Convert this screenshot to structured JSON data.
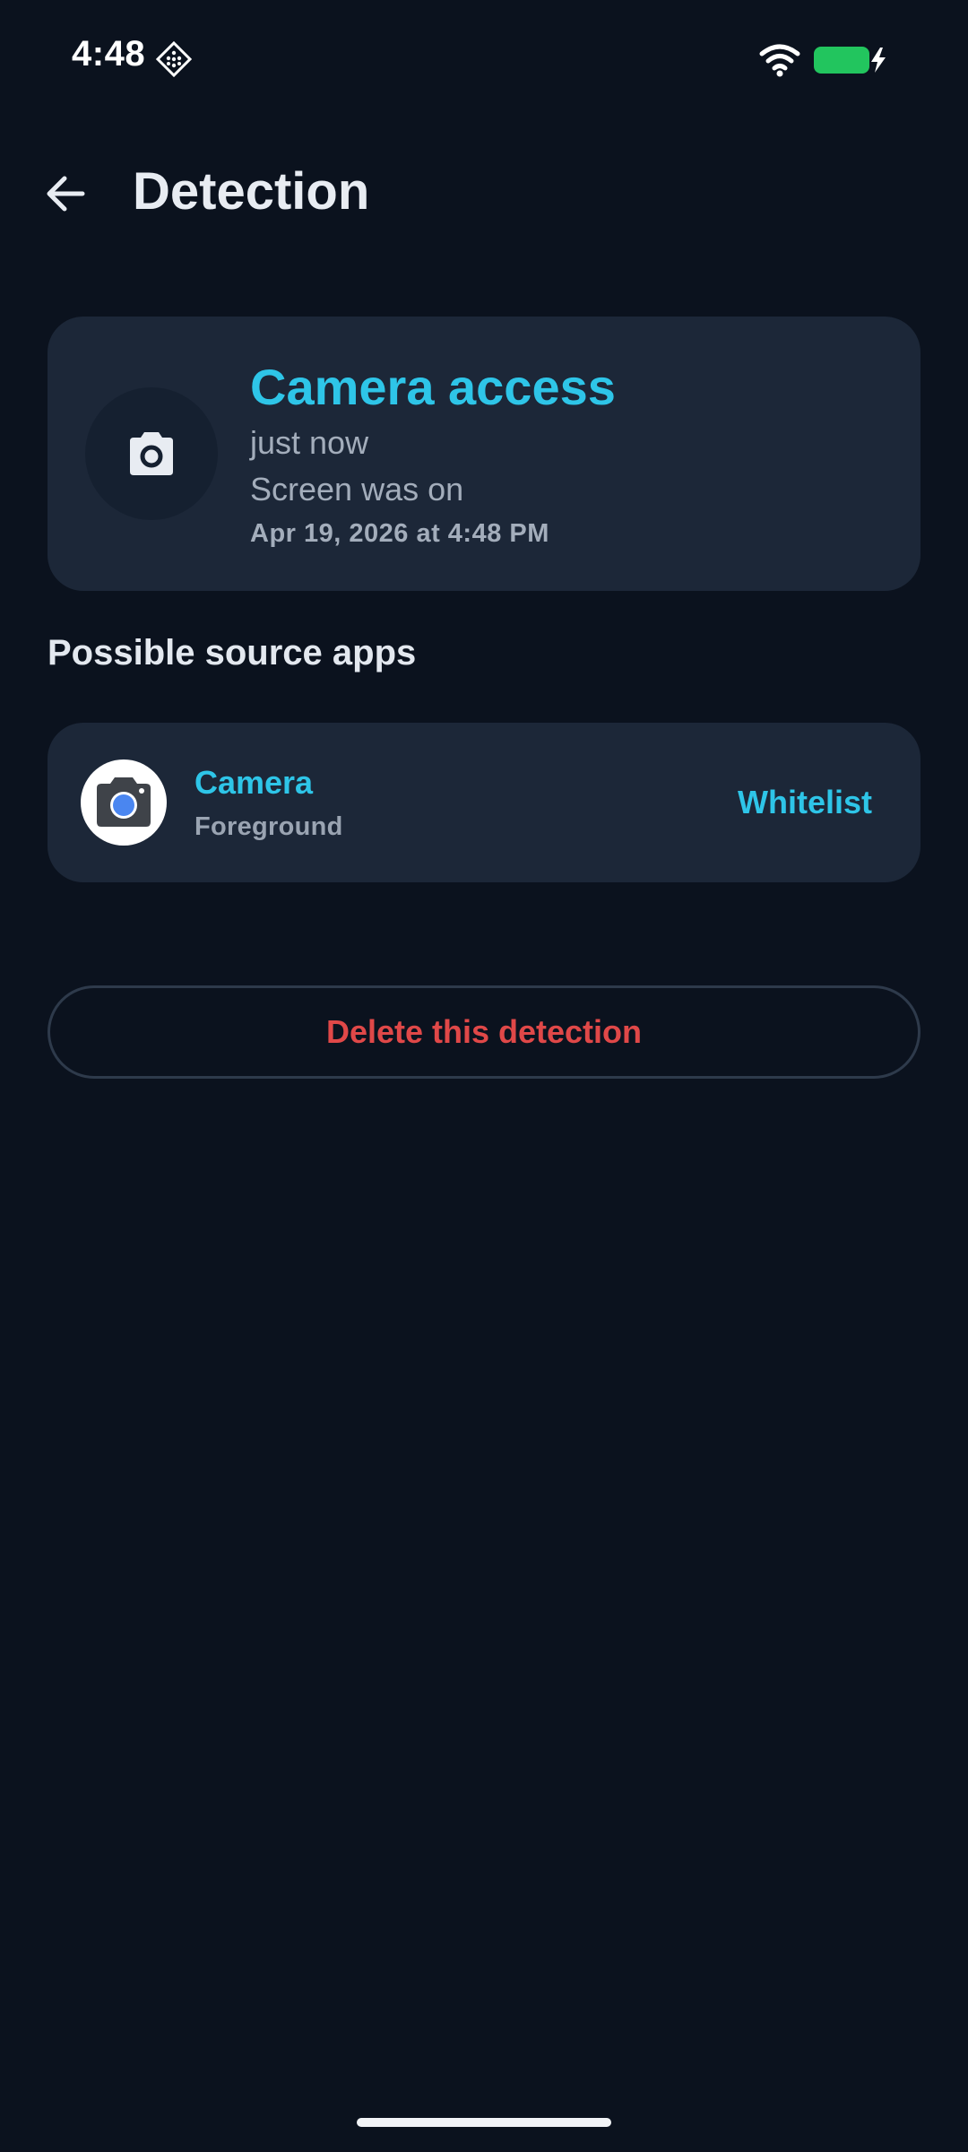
{
  "status_bar": {
    "time": "4:48",
    "battery_color": "#22c55e",
    "icons": [
      "diamond-grid-icon",
      "wifi-icon",
      "battery-charging-icon"
    ]
  },
  "app_bar": {
    "title": "Detection",
    "back_icon": "back-arrow-icon"
  },
  "summary": {
    "icon": "camera-icon",
    "title": "Camera access",
    "when": "just now",
    "screen_state": "Screen was on",
    "date": "Apr 19, 2026 at 4:48 PM"
  },
  "sources": {
    "heading": "Possible source apps",
    "apps": [
      {
        "icon": "camera-app-icon",
        "name": "Camera",
        "state": "Foreground",
        "action_label": "Whitelist"
      }
    ]
  },
  "actions": {
    "delete_label": "Delete this detection"
  },
  "colors": {
    "background": "#0b121e",
    "card": "#1c2738",
    "accent": "#2ec5e8",
    "danger": "#e04848"
  }
}
